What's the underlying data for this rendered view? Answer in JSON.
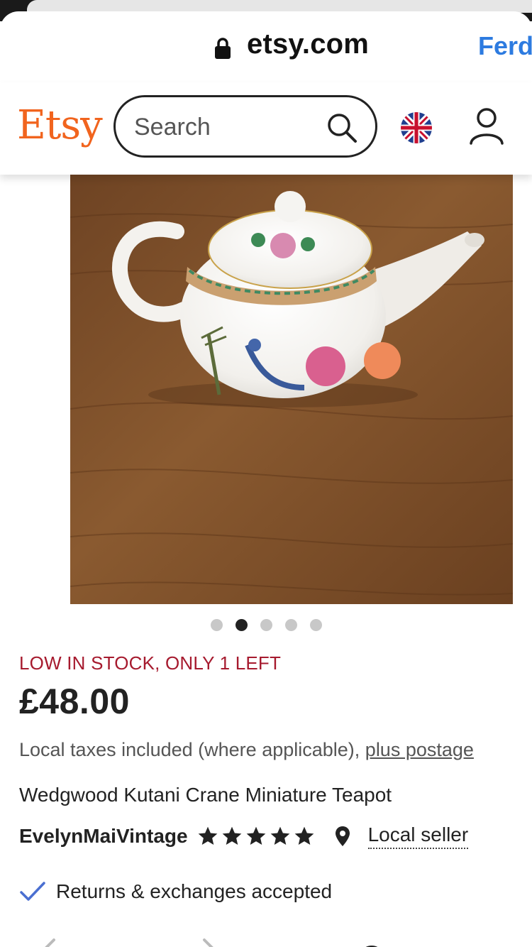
{
  "browser": {
    "url": "etsy.com",
    "right_label": "Ferd"
  },
  "header": {
    "logo": "Etsy",
    "search_placeholder": "Search"
  },
  "carousel": {
    "count": 5,
    "active_index": 1
  },
  "listing": {
    "stock_note": "LOW IN STOCK, ONLY 1 LEFT",
    "price": "£48.00",
    "taxes_text": "Local taxes included (where applicable),",
    "postage_link": "plus postage",
    "title": "Wedgwood Kutani Crane Miniature Teapot",
    "shop_name": "EvelynMaiVintage",
    "rating_stars": 5,
    "local_seller": "Local seller",
    "returns": "Returns & exchanges accepted"
  },
  "colors": {
    "brand": "#f1641e",
    "stock": "#a61a2e",
    "link_blue": "#2d7be0",
    "check_blue": "#4a6fd1"
  }
}
